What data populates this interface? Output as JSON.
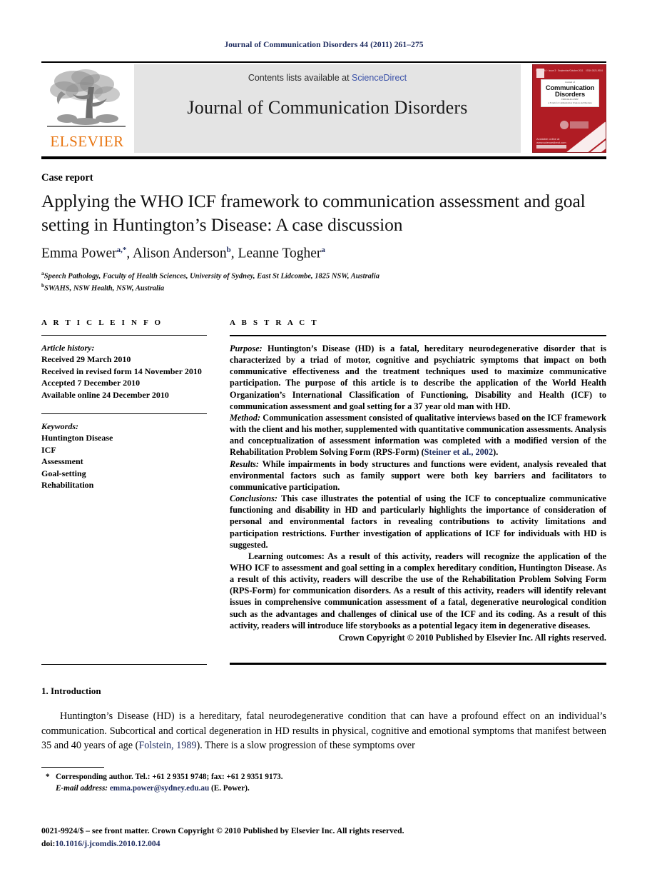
{
  "running_head": "Journal of Communication Disorders 44 (2011) 261–275",
  "header": {
    "elsevier_wordmark": "ELSEVIER",
    "contents_prefix": "Contents lists available at",
    "contents_link": "ScienceDirect",
    "journal_title": "Journal of Communication Disorders",
    "cover": {
      "top_left": "Volume 44 · Issue 3 · September/October 2011",
      "top_right": "ISSN 0021-9924",
      "kicker": "Journal of",
      "title_line1": "Communication",
      "title_line2": "Disorders",
      "subtitle_line1": "EDITOR-IN-CHIEF",
      "subtitle_line2": "A Forum for Communication Sciences and Disorders",
      "sciencedirect": "ScienceDirect",
      "available_online": "Available online at www.sciencedirect.com"
    }
  },
  "article": {
    "type_label": "Case report",
    "title": "Applying the WHO ICF framework to communication assessment and goal setting in Huntington’s Disease: A case discussion",
    "authors": [
      {
        "name": "Emma Power",
        "marks": "a,*"
      },
      {
        "name": "Alison Anderson",
        "marks": "b"
      },
      {
        "name": "Leanne Togher",
        "marks": "a"
      }
    ],
    "affiliations": [
      {
        "mark": "a",
        "text": "Speech Pathology, Faculty of Health Sciences, University of Sydney, East St Lidcombe, 1825 NSW, Australia"
      },
      {
        "mark": "b",
        "text": "SWAHS, NSW Health, NSW, Australia"
      }
    ]
  },
  "article_info": {
    "heading": "A R T I C L E    I N F O",
    "history_label": "Article history:",
    "history": [
      "Received 29 March 2010",
      "Received in revised form 14 November 2010",
      "Accepted 7 December 2010",
      "Available online 24 December 2010"
    ],
    "keywords_label": "Keywords:",
    "keywords": [
      "Huntington Disease",
      "ICF",
      "Assessment",
      "Goal-setting",
      "Rehabilitation"
    ]
  },
  "abstract": {
    "heading": "A B S T R A C T",
    "purpose_label": "Purpose:",
    "purpose_text": " Huntington’s Disease (HD) is a fatal, hereditary neurodegenerative disorder that is characterized by a triad of motor, cognitive and psychiatric symptoms that impact on both communicative effectiveness and the treatment techniques used to maximize communicative participation. The purpose of this article is to describe the application of the World Health Organization’s International Classification of Functioning, Disability and Health (ICF) to communication assessment and goal setting for a 37 year old man with HD.",
    "method_label": "Method:",
    "method_text": " Communication assessment consisted of qualitative interviews based on the ICF framework with the client and his mother, supplemented with quantitative communication assessments. Analysis and conceptualization of assessment information was completed with a modified version of the Rehabilitation Problem Solving Form (RPS-Form) (",
    "method_citation": "Steiner et al., 2002",
    "method_text_end": ").",
    "results_label": "Results:",
    "results_text": " While impairments in body structures and functions were evident, analysis revealed that environmental factors such as family support were both key barriers and facilitators to communicative participation.",
    "conclusions_label": "Conclusions:",
    "conclusions_text": " This case illustrates the potential of using the ICF to conceptualize communicative functioning and disability in HD and particularly highlights the importance of consideration of personal and environmental factors in revealing contributions to activity limitations and participation restrictions. Further investigation of applications of ICF for individuals with HD is suggested.",
    "learning_label": "Learning outcomes:",
    "learning_text": " As a result of this activity, readers will recognize the application of the WHO ICF to assessment and goal setting in a complex hereditary condition, Huntington Disease. As a result of this activity, readers will describe the use of the Rehabilitation Problem Solving Form (RPS-Form) for communication disorders. As a result of this activity, readers will identify relevant issues in comprehensive communication assessment of a fatal, degenerative neurological condition such as the advantages and challenges of clinical use of the ICF and its coding. As a result of this activity, readers will introduce life storybooks as a potential legacy item in degenerative diseases.",
    "copyright": "Crown Copyright © 2010 Published by Elsevier Inc. All rights reserved."
  },
  "introduction": {
    "heading": "1. Introduction",
    "text_part1": "Huntington’s Disease (HD) is a hereditary, fatal neurodegenerative condition that can have a profound effect on an individual’s communication. Subcortical and cortical degeneration in HD results in physical, cognitive and emotional symptoms that manifest between 35 and 40 years of age (",
    "citation": "Folstein, 1989",
    "text_part2": "). There is a slow progression of these symptoms over"
  },
  "footer": {
    "corresponding_note": "Corresponding author. Tel.: +61 2 9351 9748; fax: +61 2 9351 9173.",
    "email_label": "E-mail address:",
    "email": "emma.power@sydney.edu.au",
    "email_suffix": " (E. Power).",
    "imprint_line": "0021-9924/$ – see front matter. Crown Copyright © 2010 Published by Elsevier Inc. All rights reserved.",
    "doi_label": "doi:",
    "doi": "10.1016/j.jcomdis.2010.12.004"
  },
  "colors": {
    "link_blue": "#1c2a5e",
    "sciencedirect_blue": "#3a51a8",
    "elsevier_orange": "#e87511",
    "cover_red": "#b01c24",
    "band_gray": "#e4e4e4"
  }
}
